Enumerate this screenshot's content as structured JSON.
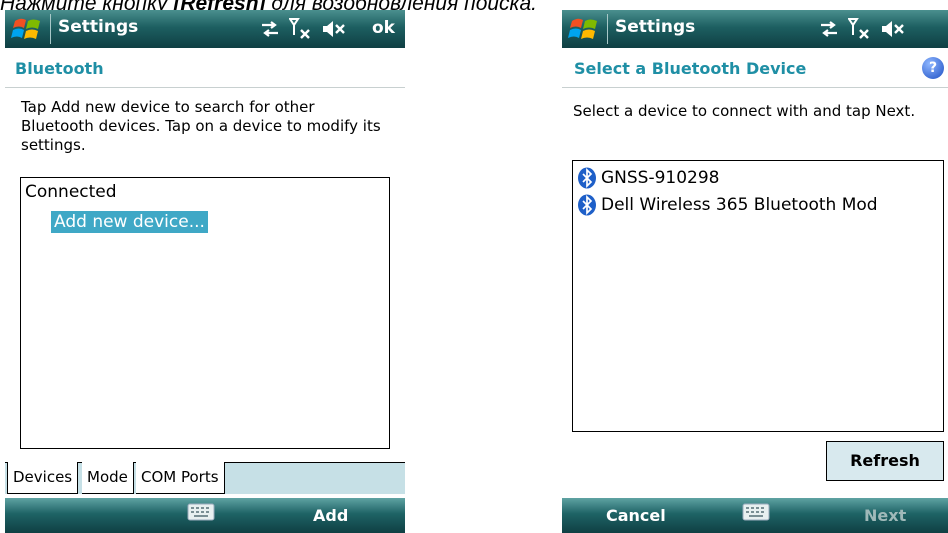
{
  "caption": {
    "prefix": "Нажмите кнопку ",
    "button": "[Refresh]",
    "suffix": " для возобновления поиска."
  },
  "left_screen": {
    "title": "Settings",
    "ok_label": "ok",
    "header": "Bluetooth",
    "description": "Tap Add new device to search for other Bluetooth devices. Tap on a device to modify its settings.",
    "tree": {
      "group": "Connected",
      "selected_item": "Add new device..."
    },
    "tabs": [
      "Devices",
      "Mode",
      "COM Ports"
    ],
    "softkey_right": "Add"
  },
  "right_screen": {
    "title": "Settings",
    "header": "Select a Bluetooth Device",
    "description": "Select a device to connect with and tap Next.",
    "devices": [
      "GNSS-910298",
      "Dell Wireless 365 Bluetooth Mod"
    ],
    "refresh_label": "Refresh",
    "softkey_left": "Cancel",
    "softkey_right": "Next"
  },
  "colors": {
    "accent": "#1f8fa5",
    "selection": "#3fa8c6",
    "titlebar": "#1d5f61"
  },
  "icons": [
    "windows-start-icon",
    "connectivity-icon",
    "signal-off-icon",
    "speaker-mute-icon",
    "keyboard-icon",
    "bluetooth-icon",
    "help-icon"
  ]
}
